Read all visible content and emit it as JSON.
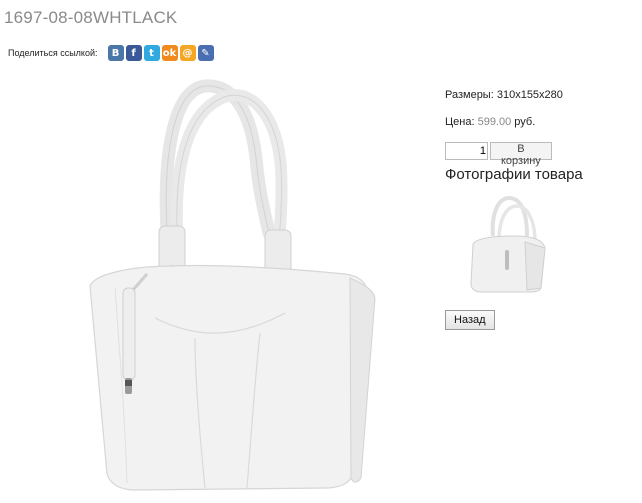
{
  "product": {
    "title": "1697-08-08WHTLACK",
    "size_label": "Размеры:",
    "size_value": "310x155x280",
    "price_label": "Цена:",
    "price_value": "599.00",
    "currency": "руб.",
    "quantity": "1",
    "add_to_cart": "В корзину",
    "photos_heading": "Фотографии товара",
    "back": "Назад"
  },
  "share": {
    "label": "Поделиться ссылкой:",
    "icons": [
      {
        "name": "vkontakte-icon",
        "glyph": "B",
        "color": "#4a76a8"
      },
      {
        "name": "facebook-icon",
        "glyph": "f",
        "color": "#3b5998"
      },
      {
        "name": "twitter-icon",
        "glyph": "t",
        "color": "#2fa9e0"
      },
      {
        "name": "odnoklassniki-icon",
        "glyph": "ok",
        "color": "#f08a1e"
      },
      {
        "name": "mailru-icon",
        "glyph": "@",
        "color": "#f5a623"
      },
      {
        "name": "livejournal-icon",
        "glyph": "✎",
        "color": "#4a6fb0"
      }
    ]
  }
}
